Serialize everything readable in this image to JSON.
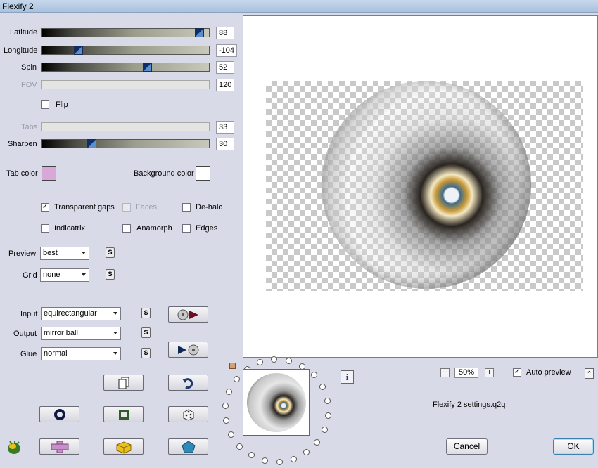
{
  "window": {
    "title": "Flexify 2"
  },
  "sliders": {
    "latitude": {
      "label": "Latitude",
      "value": "88",
      "fraction": 0.94,
      "enabled": true
    },
    "longitude": {
      "label": "Longitude",
      "value": "-104",
      "fraction": 0.22,
      "enabled": true
    },
    "spin": {
      "label": "Spin",
      "value": "52",
      "fraction": 0.63,
      "enabled": true
    },
    "fov": {
      "label": "FOV",
      "value": "120",
      "enabled": false
    },
    "tabs": {
      "label": "Tabs",
      "value": "33",
      "enabled": false
    },
    "sharpen": {
      "label": "Sharpen",
      "value": "30",
      "fraction": 0.3,
      "enabled": true
    }
  },
  "flip": {
    "label": "Flip",
    "checked": false
  },
  "colors": {
    "tab_color_label": "Tab color",
    "tab_color": "#d8a8d8",
    "background_color_label": "Background color",
    "background_color": "#ffffff"
  },
  "options": {
    "transparent_gaps": {
      "label": "Transparent gaps",
      "checked": true
    },
    "faces": {
      "label": "Faces",
      "checked": false,
      "enabled": false
    },
    "de_halo": {
      "label": "De-halo",
      "checked": false
    },
    "indicatrix": {
      "label": "Indicatrix",
      "checked": false
    },
    "anamorph": {
      "label": "Anamorph",
      "checked": false
    },
    "edges": {
      "label": "Edges",
      "checked": false
    }
  },
  "preview_select": {
    "label": "Preview",
    "value": "best"
  },
  "grid_select": {
    "label": "Grid",
    "value": "none"
  },
  "input_select": {
    "label": "Input",
    "value": "equirectangular"
  },
  "output_select": {
    "label": "Output",
    "value": "mirror ball"
  },
  "glue_select": {
    "label": "Glue",
    "value": "normal"
  },
  "s_label": "S",
  "info_label": "i",
  "zoom": {
    "minus": "−",
    "value": "50%",
    "plus": "+"
  },
  "auto_preview": {
    "label": "Auto preview",
    "checked": true
  },
  "expand_label": "^",
  "settings_file": "Flexify 2 settings.q2q",
  "buttons": {
    "cancel": "Cancel",
    "ok": "OK"
  },
  "icons": [
    "disc-right-arrow-icon",
    "right-arrow-disc-icon",
    "copy-icon",
    "undo-icon",
    "ring-icon",
    "frame-icon",
    "dice-icon",
    "plugin-logo-icon",
    "cross-shape-icon",
    "cube-icon",
    "pentagon-icon"
  ]
}
